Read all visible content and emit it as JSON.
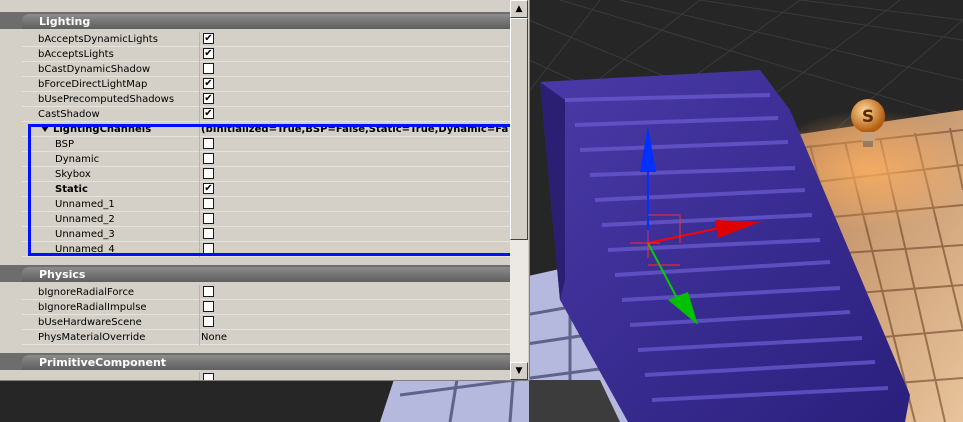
{
  "sections": {
    "lighting": "Lighting",
    "physics": "Physics",
    "primitive": "PrimitiveComponent"
  },
  "lighting_props": [
    {
      "name": "bAcceptsDynamicLights",
      "checked": true
    },
    {
      "name": "bAcceptsLights",
      "checked": true
    },
    {
      "name": "bCastDynamicShadow",
      "checked": false
    },
    {
      "name": "bForceDirectLightMap",
      "checked": true
    },
    {
      "name": "bUsePrecomputedShadows",
      "checked": true
    },
    {
      "name": "CastShadow",
      "checked": true
    }
  ],
  "lighting_channels": {
    "name": "LightingChannels",
    "value": "(bInitialized=True,BSP=False,Static=True,Dynamic=Fa",
    "items": [
      {
        "name": "BSP",
        "checked": false
      },
      {
        "name": "Dynamic",
        "checked": false
      },
      {
        "name": "Skybox",
        "checked": false
      },
      {
        "name": "Static",
        "checked": true
      },
      {
        "name": "Unnamed_1",
        "checked": false
      },
      {
        "name": "Unnamed_2",
        "checked": false
      },
      {
        "name": "Unnamed_3",
        "checked": false
      },
      {
        "name": "Unnamed_4",
        "checked": false
      }
    ]
  },
  "physics_props": [
    {
      "name": "bIgnoreRadialForce",
      "checked": false
    },
    {
      "name": "bIgnoreRadialImpulse",
      "checked": false
    },
    {
      "name": "bUseHardwareScene",
      "checked": false
    }
  ],
  "phys_material": {
    "name": "PhysMaterialOverride",
    "value": "None"
  },
  "checkmark": "✔",
  "scroll": {
    "up": "▲",
    "down": "▼"
  },
  "viewport": {
    "light_icon_letter": "S",
    "colors": {
      "stairs": "#3b2e9a",
      "x_axis": "#ff0000",
      "y_axis": "#00d000",
      "z_axis": "#0030ff",
      "selection": "#0010ff"
    }
  }
}
